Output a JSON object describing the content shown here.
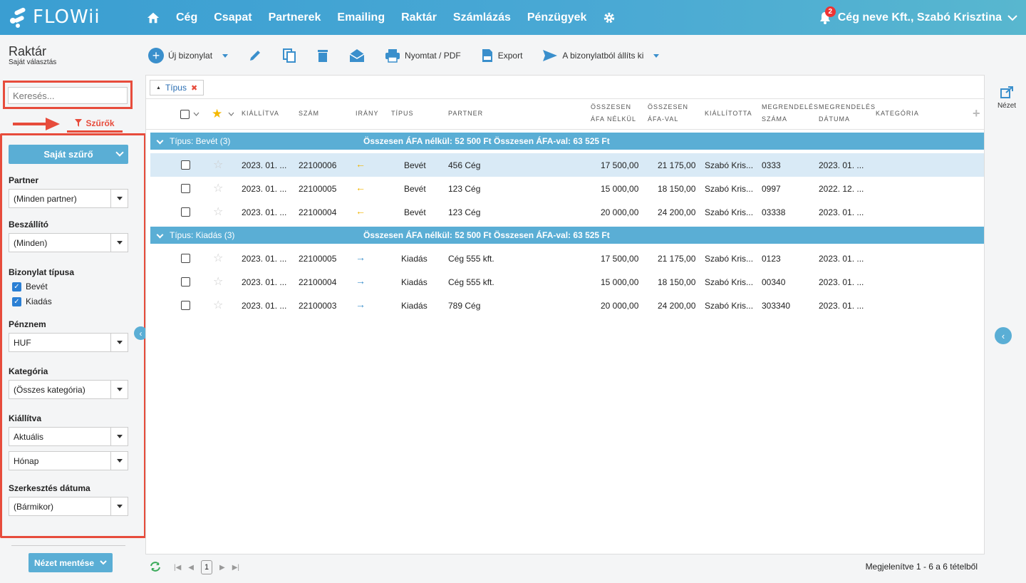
{
  "app": {
    "logo_text": "FLOWii"
  },
  "nav": {
    "items": [
      "Cég",
      "Csapat",
      "Partnerek",
      "Emailing",
      "Raktár",
      "Számlázás",
      "Pénzügyek"
    ],
    "notifications": "2",
    "user": "Cég neve Kft., Szabó Krisztina"
  },
  "page": {
    "title": "Raktár",
    "subtitle": "Saját választás"
  },
  "toolbar": {
    "new_doc": "Új bizonylat",
    "print": "Nyomtat / PDF",
    "export": "Export",
    "issue_from": "A bizonylatból állíts ki"
  },
  "sidebar": {
    "search_placeholder": "Keresés...",
    "filters_tab": "Szűrők",
    "own_filter": "Saját szűrő",
    "partner_label": "Partner",
    "partner_value": "(Minden partner)",
    "supplier_label": "Beszállító",
    "supplier_value": "(Minden)",
    "doctype_label": "Bizonylat típusa",
    "doctype_opt1": "Bevét",
    "doctype_opt2": "Kiadás",
    "currency_label": "Pénznem",
    "currency_value": "HUF",
    "category_label": "Kategória",
    "category_value": "(Összes kategória)",
    "issued_label": "Kiállítva",
    "issued_value1": "Aktuális",
    "issued_value2": "Hónap",
    "edited_label": "Szerkesztés dátuma",
    "edited_value": "(Bármikor)",
    "save_view": "Nézet mentése"
  },
  "grid": {
    "group_tag": "Típus",
    "headers": {
      "issued": "KIÁLLÍTVA",
      "number": "SZÁM",
      "direction": "IRÁNY",
      "type": "TÍPUS",
      "partner": "PARTNER",
      "net_1": "ÖSSZESEN",
      "net_2": "ÁFA NÉLKÜL",
      "gross_1": "ÖSSZESEN",
      "gross_2": "ÁFA-VAL",
      "issuer": "KIÁLLÍTOTTA",
      "order_no_1": "MEGRENDELÉS",
      "order_no_2": "SZÁMA",
      "order_date_1": "MEGRENDELÉS",
      "order_date_2": "DÁTUMA",
      "category": "KATEGÓRIA"
    },
    "groups": [
      {
        "title": "Típus: Bevét (3)",
        "net_label": "Összesen ÁFA nélkül:",
        "net_value": "52 500 Ft",
        "gross_label": "Összesen ÁFA-val:",
        "gross_value": "63 525 Ft",
        "rows": [
          {
            "issued": "2023. 01. ...",
            "number": "22100006",
            "type": "Bevét",
            "partner": "456 Cég",
            "net": "17 500,00",
            "gross": "21 175,00",
            "issuer": "Szabó Kris...",
            "order_no": "0333",
            "order_date": "2023. 01. ..."
          },
          {
            "issued": "2023. 01. ...",
            "number": "22100005",
            "type": "Bevét",
            "partner": "123 Cég",
            "net": "15 000,00",
            "gross": "18 150,00",
            "issuer": "Szabó Kris...",
            "order_no": "0997",
            "order_date": "2022. 12. ..."
          },
          {
            "issued": "2023. 01. ...",
            "number": "22100004",
            "type": "Bevét",
            "partner": "123 Cég",
            "net": "20 000,00",
            "gross": "24 200,00",
            "issuer": "Szabó Kris...",
            "order_no": "03338",
            "order_date": "2023. 01. ..."
          }
        ]
      },
      {
        "title": "Típus: Kiadás (3)",
        "net_label": "Összesen ÁFA nélkül:",
        "net_value": "52 500 Ft",
        "gross_label": "Összesen ÁFA-val:",
        "gross_value": "63 525 Ft",
        "rows": [
          {
            "issued": "2023. 01. ...",
            "number": "22100005",
            "type": "Kiadás",
            "partner": "Cég 555 kft.",
            "net": "17 500,00",
            "gross": "21 175,00",
            "issuer": "Szabó Kris...",
            "order_no": "0123",
            "order_date": "2023. 01. ..."
          },
          {
            "issued": "2023. 01. ...",
            "number": "22100004",
            "type": "Kiadás",
            "partner": "Cég 555 kft.",
            "net": "15 000,00",
            "gross": "18 150,00",
            "issuer": "Szabó Kris...",
            "order_no": "00340",
            "order_date": "2023. 01. ..."
          },
          {
            "issued": "2023. 01. ...",
            "number": "22100003",
            "type": "Kiadás",
            "partner": "789 Cég",
            "net": "20 000,00",
            "gross": "24 200,00",
            "issuer": "Szabó Kris...",
            "order_no": "303340",
            "order_date": "2023. 01. ..."
          }
        ]
      }
    ],
    "page": "1",
    "records_info": "Megjelenítve 1 - 6 a 6 tételből"
  },
  "right": {
    "view_label": "Nézet"
  },
  "colors": {
    "topbar": "#3a9ed2",
    "accent": "#5aaed5",
    "highlight": "#e74c3c",
    "selected_row": "#d9eaf6"
  }
}
